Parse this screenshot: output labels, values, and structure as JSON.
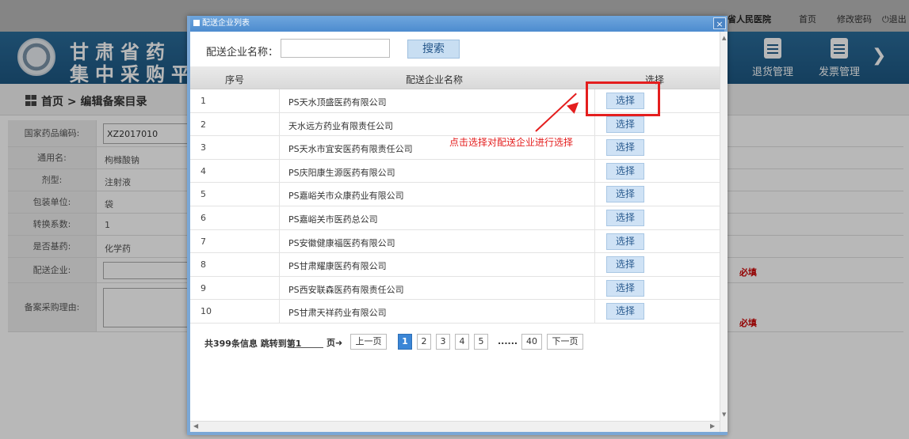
{
  "background": {
    "hospital": "省人民医院",
    "top_links": [
      "首页",
      "修改密码",
      "退出"
    ],
    "brand_line1": "甘肃省药",
    "brand_line2": "集中采购平",
    "nav": [
      "退货管理",
      "发票管理"
    ],
    "breadcrumb": "首页 > 编辑备案目录",
    "form": {
      "drug_code_label": "国家药品编码:",
      "drug_code_value": "XZ2017010",
      "generic_label": "通用名:",
      "generic_value": "枸橼酸钠",
      "dosage_label": "剂型:",
      "dosage_value": "注射液",
      "pack_label": "包装单位:",
      "pack_value": "袋",
      "conv_label": "转换系数:",
      "conv_value": "1",
      "base_label": "是否基药:",
      "base_value": "化学药",
      "enterprise_label": "配送企业:",
      "reason_label": "备案采购理由:",
      "required": "必填"
    }
  },
  "modal": {
    "title": "配送企业列表",
    "close_icon": "×",
    "search": {
      "label": "配送企业名称：",
      "value": "",
      "button": "搜索"
    },
    "table": {
      "columns": [
        "序号",
        "配送企业名称",
        "选择"
      ],
      "button_label": "选择",
      "rows": [
        {
          "no": "1",
          "name": "PS天水顶盛医药有限公司"
        },
        {
          "no": "2",
          "name": "天水远方药业有限责任公司"
        },
        {
          "no": "3",
          "name": "PS天水市宜安医药有限责任公司"
        },
        {
          "no": "4",
          "name": "PS庆阳康生源医药有限公司"
        },
        {
          "no": "5",
          "name": "PS嘉峪关市众康药业有限公司"
        },
        {
          "no": "6",
          "name": "PS嘉峪关市医药总公司"
        },
        {
          "no": "7",
          "name": "PS安徽健康福医药有限公司"
        },
        {
          "no": "8",
          "name": "PS甘肃耀康医药有限公司"
        },
        {
          "no": "9",
          "name": "PS西安联森医药有限责任公司"
        },
        {
          "no": "10",
          "name": "PS甘肃天祥药业有限公司"
        }
      ]
    },
    "annotation": "点击选择对配送企业进行选择",
    "pager": {
      "info": "共399条信息 跳转到第1",
      "go": "页➜",
      "prev": "上一页",
      "pages": [
        "1",
        "2",
        "3",
        "4",
        "5"
      ],
      "dots": "......",
      "last": "40",
      "next": "下一页",
      "current": "1"
    }
  },
  "colors": {
    "modal_border": "#7aa7d6",
    "highlight": "#e41e1e",
    "button_bg": "#cfe2f5"
  }
}
